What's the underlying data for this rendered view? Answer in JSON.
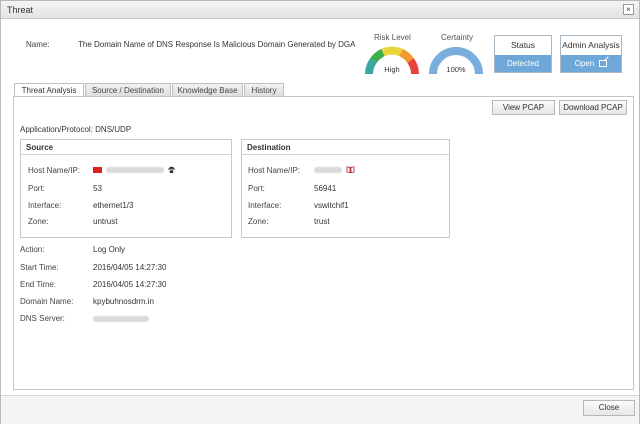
{
  "window": {
    "title": "Threat",
    "close_glyph": "×"
  },
  "header": {
    "name_label": "Name:",
    "name_value": "The Domain Name of DNS Response Is Malicious Domain Generated by DGA",
    "risk_level": {
      "label": "Risk Level",
      "value": "High"
    },
    "certainty": {
      "label": "Certainty",
      "value": "100%",
      "fraction": 1.0
    },
    "status": {
      "label": "Status",
      "value": "Detected"
    },
    "admin_analysis": {
      "label": "Admin Analysis",
      "value": "Open"
    }
  },
  "tabs": [
    {
      "label": "Threat Analysis",
      "active": true
    },
    {
      "label": "Source / Destination",
      "active": false
    },
    {
      "label": "Knowledge Base",
      "active": false
    },
    {
      "label": "History",
      "active": false
    }
  ],
  "toolbar": {
    "view_pcap": "View PCAP",
    "download_pcap": "Download PCAP"
  },
  "app_protocol": "Application/Protocol: DNS/UDP",
  "source": {
    "title": "Source",
    "host_label": "Host Name/IP:",
    "port_label": "Port:",
    "port_value": "53",
    "interface_label": "Interface:",
    "interface_value": "ethernet1/3",
    "zone_label": "Zone:",
    "zone_value": "untrust"
  },
  "destination": {
    "title": "Destination",
    "host_label": "Host Name/IP:",
    "port_label": "Port:",
    "port_value": "56941",
    "interface_label": "Interface:",
    "interface_value": "vswitchif1",
    "zone_label": "Zone:",
    "zone_value": "trust"
  },
  "details": {
    "action_label": "Action:",
    "action_value": "Log Only",
    "start_label": "Start Time:",
    "start_value": "2016/04/05 14:27:30",
    "end_label": "End Time:",
    "end_value": "2016/04/05 14:27:30",
    "domain_label": "Domain Name:",
    "domain_value": "kpybuhnosdrm.in",
    "dns_label": "DNS Server:"
  },
  "footer": {
    "close_label": "Close"
  },
  "colors": {
    "accent": "#6fa7d8",
    "risk_red": "#e5433b",
    "risk_orange": "#f39a2d",
    "risk_yellow": "#e8d63a",
    "risk_green": "#3fae49",
    "risk_teal": "#3aa6a0",
    "certainty_blue": "#7aaede"
  },
  "icons": {
    "source_flag": "china-flag-icon",
    "source_badge": "hacker-icon",
    "destination_badge": "book-icon"
  }
}
